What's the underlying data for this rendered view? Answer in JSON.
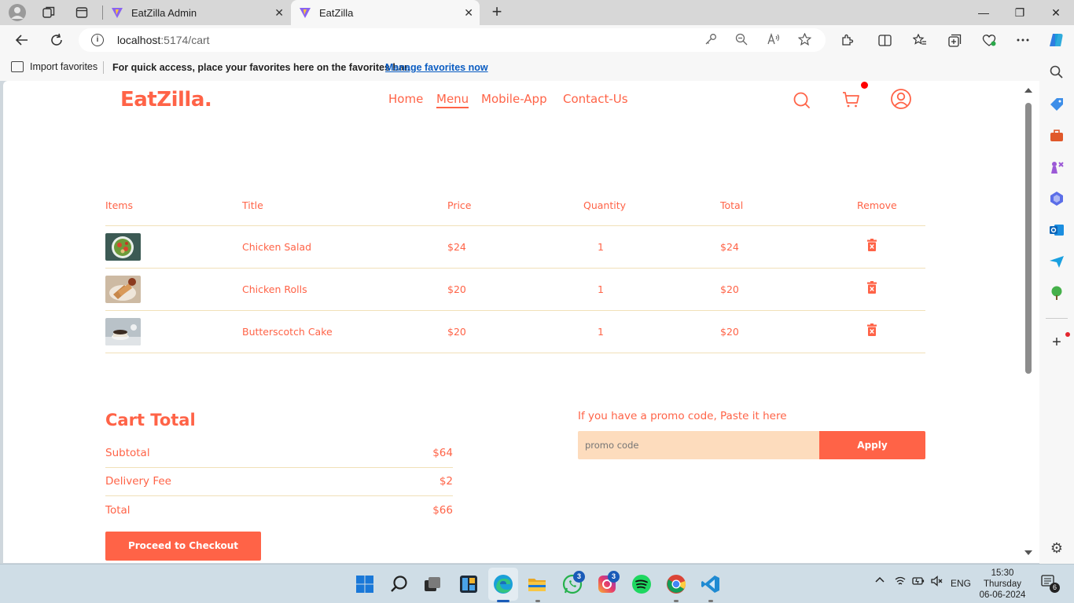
{
  "browser": {
    "tabs": [
      {
        "label": "EatZilla Admin",
        "active": false
      },
      {
        "label": "EatZilla",
        "active": true
      }
    ],
    "new_tab": "+",
    "window_controls": {
      "minimize": "—",
      "maximize": "❐",
      "close": "✕"
    },
    "url": {
      "host": "localhost",
      "path": ":5174/cart"
    },
    "favorites_bar": {
      "import_label": "Import favorites",
      "message": "For quick access, place your favorites here on the favorites bar.",
      "link": "Manage favorites now"
    }
  },
  "site": {
    "colors": {
      "accent": "#ff6347",
      "promo_bg": "#fddcbd",
      "divider": "#f1e0b8"
    },
    "logo": "EatZilla.",
    "nav": [
      {
        "label": "Home",
        "active": false
      },
      {
        "label": "Menu",
        "active": true
      },
      {
        "label": "Mobile-App",
        "active": false
      },
      {
        "label": "Contact-Us",
        "active": false
      }
    ],
    "icons": [
      "search-icon",
      "cart-icon",
      "profile-icon"
    ]
  },
  "cart": {
    "headers": [
      "Items",
      "Title",
      "Price",
      "Quantity",
      "Total",
      "Remove"
    ],
    "items": [
      {
        "title": "Chicken Salad",
        "price": "$24",
        "quantity": "1",
        "total": "$24"
      },
      {
        "title": "Chicken Rolls",
        "price": "$20",
        "quantity": "1",
        "total": "$20"
      },
      {
        "title": "Butterscotch Cake",
        "price": "$20",
        "quantity": "1",
        "total": "$20"
      }
    ]
  },
  "summary": {
    "title": "Cart Total",
    "rows": [
      {
        "label": "Subtotal",
        "value": "$64"
      },
      {
        "label": "Delivery Fee",
        "value": "$2"
      },
      {
        "label": "Total",
        "value": "$66"
      }
    ],
    "checkout_label": "Proceed to Checkout"
  },
  "promo": {
    "label": "If you have a promo code, Paste it here",
    "placeholder": "promo code",
    "button": "Apply"
  },
  "taskbar": {
    "badges": {
      "whatsapp": "3",
      "instagram": "3"
    },
    "lang": "ENG",
    "time": "15:30",
    "day": "Thursday",
    "date": "06-06-2024",
    "notifications": "6"
  }
}
